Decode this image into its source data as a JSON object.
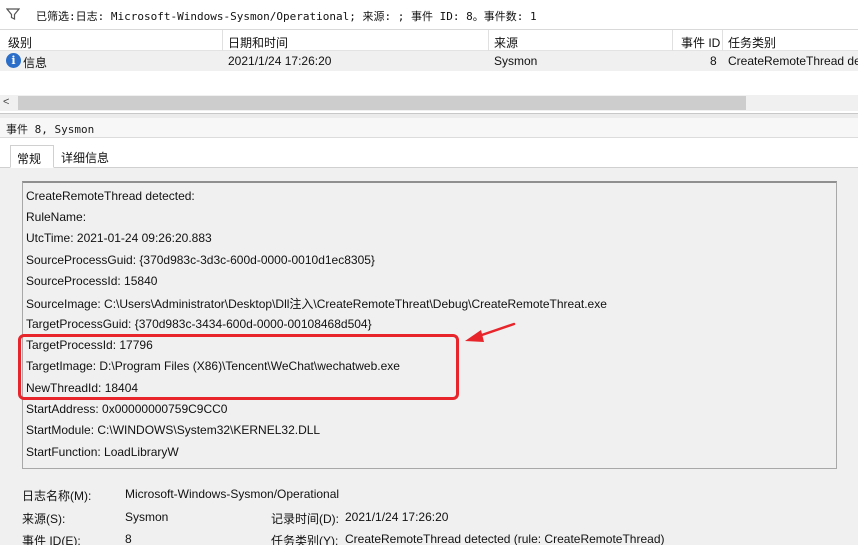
{
  "filter_bar": {
    "icon": "filter-icon",
    "text": "已筛选:日志: Microsoft-Windows-Sysmon/Operational; 来源: ; 事件 ID: 8。事件数: 1"
  },
  "grid": {
    "columns": [
      "级别",
      "日期和时间",
      "来源",
      "事件 ID",
      "任务类别"
    ],
    "rows": [
      {
        "icon": "info-icon",
        "level": "信息",
        "datetime": "2021/1/24 17:26:20",
        "source": "Sysmon",
        "event_id": "8",
        "task_category": "CreateRemoteThread detec"
      }
    ],
    "scroll_left_glyph": "<"
  },
  "detail": {
    "title": "事件 8, Sysmon",
    "tabs": [
      {
        "label": "常规",
        "active": true
      },
      {
        "label": "详细信息",
        "active": false
      }
    ],
    "lines": [
      "CreateRemoteThread detected:",
      "RuleName:",
      "UtcTime: 2021-01-24 09:26:20.883",
      "SourceProcessGuid: {370d983c-3d3c-600d-0000-0010d1ec8305}",
      "SourceProcessId: 15840",
      "SourceImage: C:\\Users\\Administrator\\Desktop\\Dll注入\\CreateRemoteThreat\\Debug\\CreateRemoteThreat.exe",
      "TargetProcessGuid: {370d983c-3434-600d-0000-00108468d504}",
      "TargetProcessId: 17796",
      "TargetImage: D:\\Program Files (X86)\\Tencent\\WeChat\\wechatweb.exe",
      "NewThreadId: 18404",
      "StartAddress: 0x00000000759C9CC0",
      "StartModule: C:\\WINDOWS\\System32\\KERNEL32.DLL",
      "StartFunction: LoadLibraryW"
    ],
    "highlight_color": "#e8252a"
  },
  "meta": {
    "log_name_label": "日志名称(M):",
    "log_name_value": "Microsoft-Windows-Sysmon/Operational",
    "source_label": "来源(S):",
    "source_value": "Sysmon",
    "logged_label": "记录时间(D):",
    "logged_value": "2021/1/24 17:26:20",
    "event_id_label": "事件 ID(E):",
    "event_id_value": "8",
    "task_label": "任务类别(Y):",
    "task_value": "CreateRemoteThread detected (rule: CreateRemoteThread)"
  }
}
